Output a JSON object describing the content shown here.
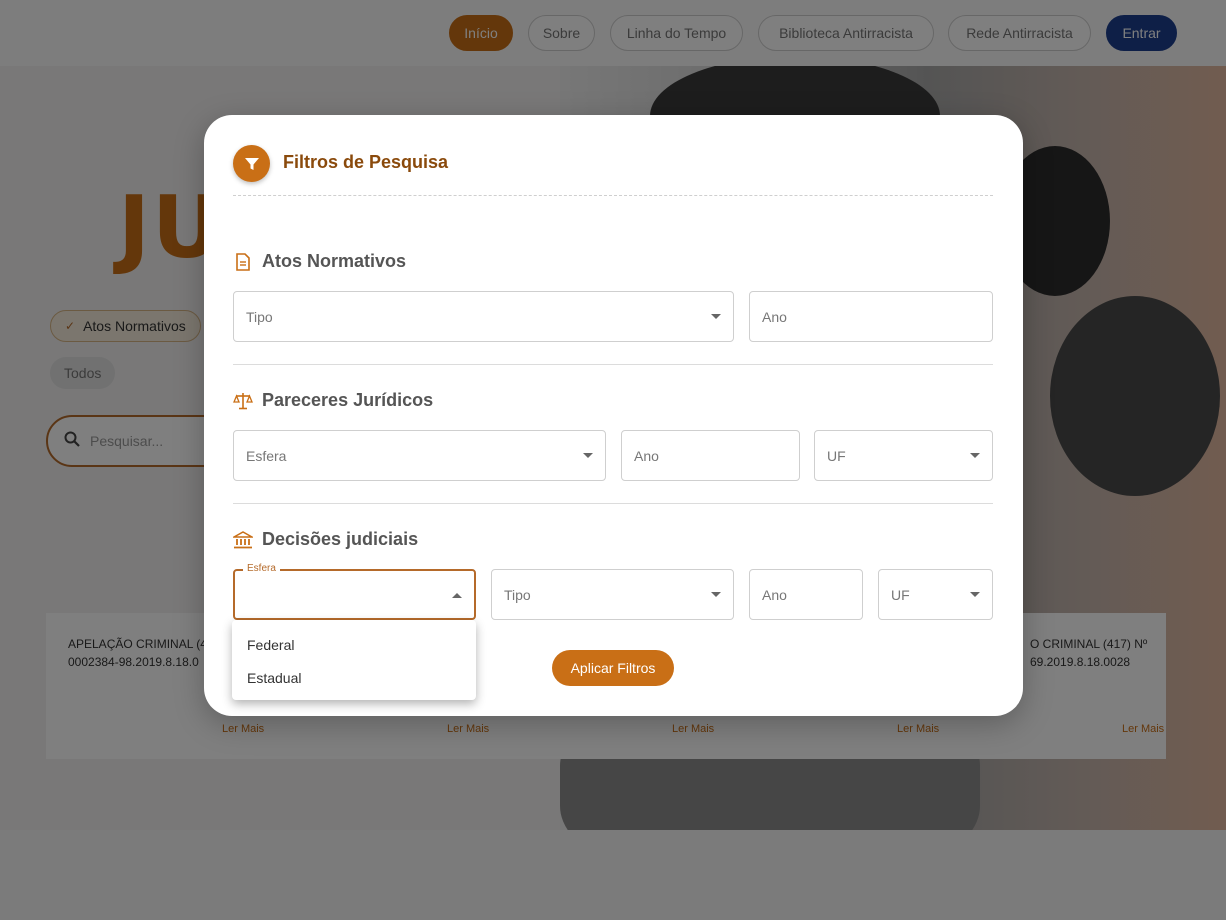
{
  "nav": {
    "items": [
      {
        "label": "Início",
        "active": true
      },
      {
        "label": "Sobre"
      },
      {
        "label": "Linha do Tempo"
      },
      {
        "label": "Biblioteca Antirracista"
      },
      {
        "label": "Rede Antirracista"
      }
    ],
    "login_label": "Entrar"
  },
  "page": {
    "title_fragment": "JU",
    "chips": {
      "atos": "Atos Normativos",
      "todos": "Todos"
    },
    "search_placeholder": "Pesquisar...",
    "cards": [
      {
        "text": "APELAÇÃO CRIMINAL (4",
        "text2": "0002384-98.2019.8.18.0",
        "read_more": "Ler Mais"
      },
      {
        "read_more": "Ler Mais"
      },
      {
        "read_more": "Ler Mais"
      },
      {
        "read_more": "Ler Mais"
      },
      {
        "text": "O CRIMINAL (417) Nº",
        "text2": "69.2019.8.18.0028",
        "read_more": "Ler Mais"
      }
    ]
  },
  "modal": {
    "title": "Filtros de Pesquisa",
    "sections": {
      "atos": {
        "title": "Atos Normativos",
        "fields": {
          "tipo": "Tipo",
          "ano": "Ano"
        }
      },
      "pareceres": {
        "title": "Pareceres Jurídicos",
        "fields": {
          "esfera": "Esfera",
          "ano": "Ano",
          "uf": "UF"
        }
      },
      "decisoes": {
        "title": "Decisões judiciais",
        "fields": {
          "esfera_label": "Esfera",
          "tipo": "Tipo",
          "ano": "Ano",
          "uf": "UF"
        }
      }
    },
    "dropdown_options": [
      "Federal",
      "Estadual"
    ],
    "apply_label": "Aplicar Filtros"
  },
  "colors": {
    "accent": "#c96f16",
    "login": "#1d3f8f",
    "title_brown": "#8a4a0c"
  }
}
